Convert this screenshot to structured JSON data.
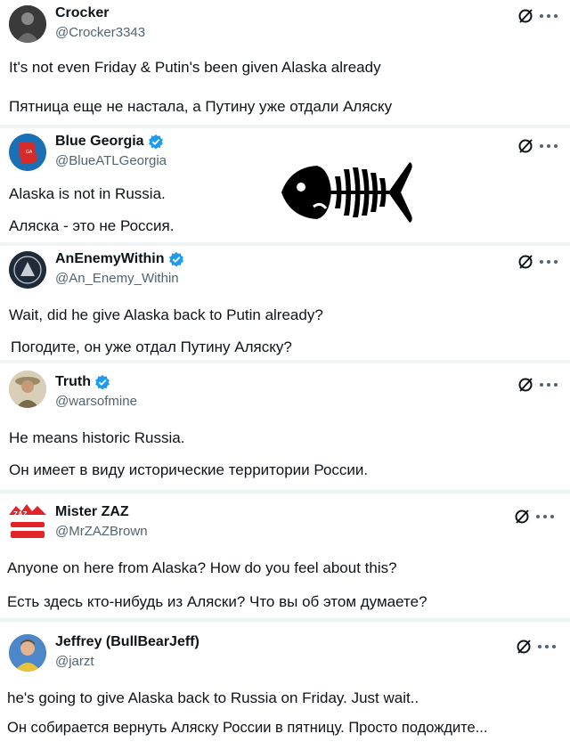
{
  "tweets": [
    {
      "name": "Crocker",
      "handle": "@Crocker3343",
      "verified": false,
      "text_en": "It's not even Friday & Putin's been given Alaska already",
      "text_ru": "Пятница еще не настала, а Путину уже отдали Аляску"
    },
    {
      "name": "Blue Georgia",
      "handle": "@BlueATLGeorgia",
      "verified": true,
      "text_en": "Alaska is not in Russia.",
      "text_ru": "Аляска - это не Россия."
    },
    {
      "name": "AnEnemyWithin",
      "handle": "@An_Enemy_Within",
      "verified": true,
      "text_en": "Wait, did he give Alaska back to Putin already?",
      "text_ru": "Погодите, он уже отдал Путину Аляску?"
    },
    {
      "name": "Truth",
      "handle": "@warsofmine",
      "verified": true,
      "text_en": "He means historic Russia.",
      "text_ru": "Он имеет в виду исторические территории России."
    },
    {
      "name": "Mister ZAZ",
      "handle": "@MrZAZBrown",
      "verified": false,
      "text_en": "Anyone on here from Alaska? How do you feel about this?",
      "text_ru": "Есть здесь кто-нибудь из Аляски? Что вы об этом думаете?"
    },
    {
      "name": "Jeffrey (BullBearJeff)",
      "handle": "@jarzt",
      "verified": false,
      "text_en": "he's going to give Alaska back to Russia on Friday. Just wait..",
      "text_ru": "Он собирается вернуть Аляску России в пятницу. Просто подождите..."
    }
  ],
  "icons": {
    "grok": "grok-icon",
    "more": "more-options-icon",
    "verified": "verified-badge-icon",
    "watermark": "fish-skeleton-watermark"
  },
  "colors": {
    "verified": "#1d9bf0",
    "name": "#0f1419",
    "handle": "#536471",
    "separator": "#eff3f4"
  }
}
